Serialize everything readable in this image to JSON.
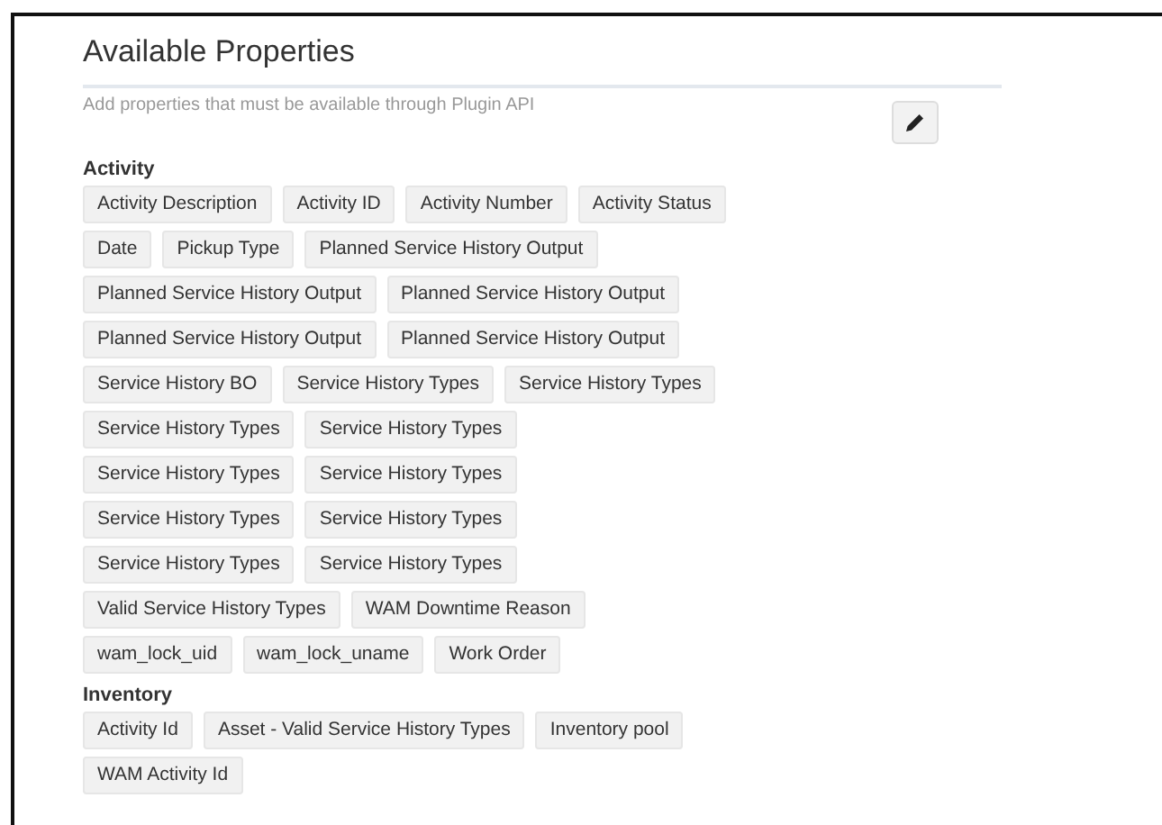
{
  "title": "Available Properties",
  "description": "Add properties that must be available through Plugin API",
  "sections": [
    {
      "heading": "Activity",
      "rows": [
        [
          "Activity Description",
          "Activity ID",
          "Activity Number",
          "Activity Status"
        ],
        [
          "Date",
          "Pickup Type",
          "Planned Service History Output"
        ],
        [
          "Planned Service History Output",
          "Planned Service History Output"
        ],
        [
          "Planned Service History Output",
          "Planned Service History Output"
        ],
        [
          "Service History BO",
          "Service History Types",
          "Service History Types"
        ],
        [
          "Service History Types",
          "Service History Types"
        ],
        [
          "Service History Types",
          "Service History Types"
        ],
        [
          "Service History Types",
          "Service History Types"
        ],
        [
          "Service History Types",
          "Service History Types"
        ],
        [
          "Valid Service History Types",
          "WAM Downtime Reason"
        ],
        [
          "wam_lock_uid",
          "wam_lock_uname",
          "Work Order"
        ]
      ]
    },
    {
      "heading": "Inventory",
      "rows": [
        [
          "Activity Id",
          "Asset - Valid Service History Types",
          "Inventory pool"
        ],
        [
          "WAM Activity Id"
        ]
      ]
    }
  ]
}
